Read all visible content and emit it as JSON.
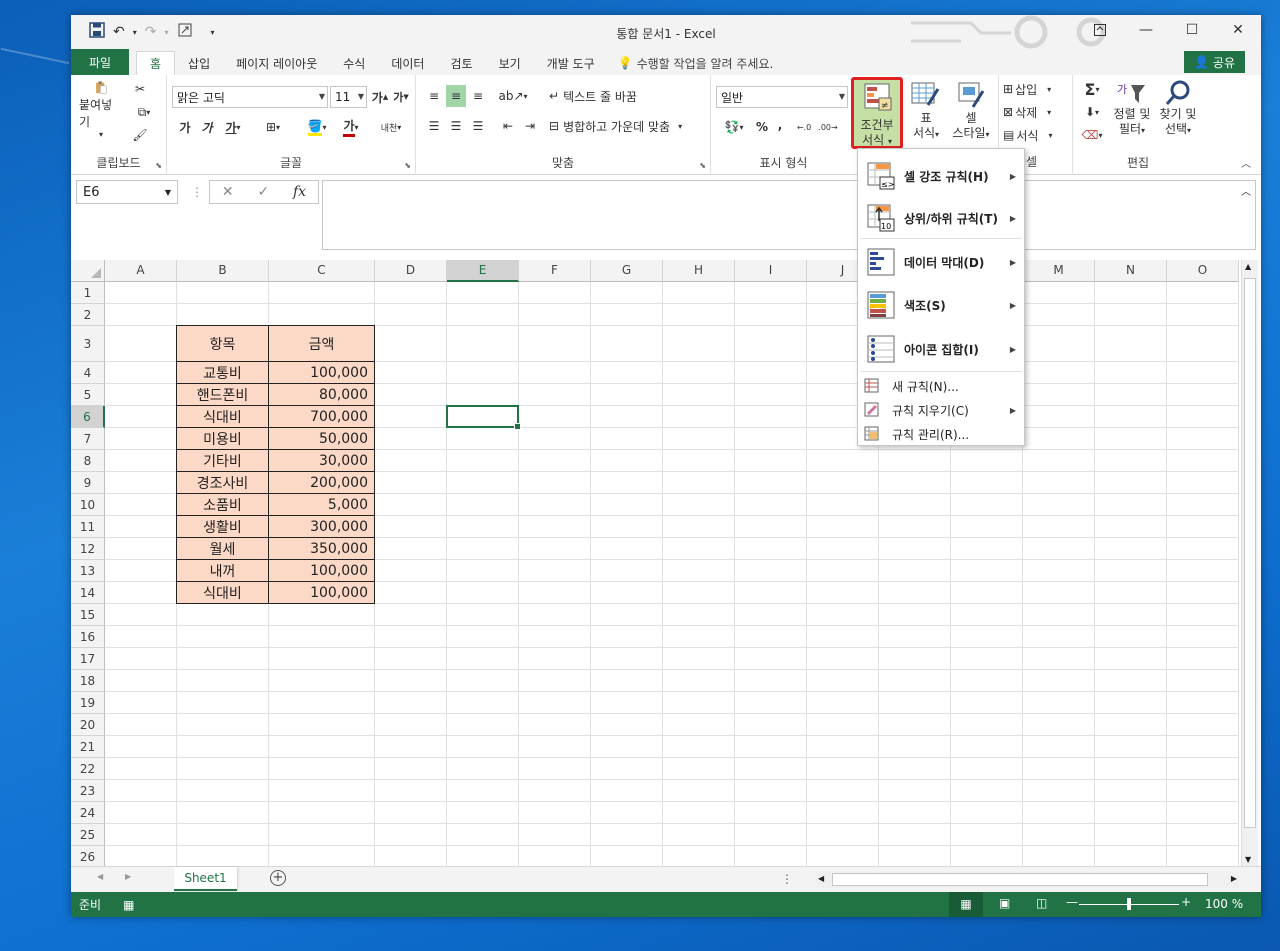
{
  "window": {
    "title": "통합 문서1  -  Excel"
  },
  "tabs": [
    {
      "label": "파일"
    },
    {
      "label": "홈"
    },
    {
      "label": "삽입"
    },
    {
      "label": "페이지 레이아웃"
    },
    {
      "label": "수식"
    },
    {
      "label": "데이터"
    },
    {
      "label": "검토"
    },
    {
      "label": "보기"
    },
    {
      "label": "개발 도구"
    }
  ],
  "tell_me": "수행할 작업을 알려 주세요.",
  "share": "공유",
  "ribbon": {
    "clipboard": {
      "paste": "붙여넣기",
      "label": "클립보드"
    },
    "font": {
      "name": "맑은 고딕",
      "size": "11",
      "bold": "가",
      "italic": "가",
      "underline": "가",
      "label": "글꼴",
      "grow": "가",
      "shrink": "가",
      "phonetic": "내천"
    },
    "alignment": {
      "wrap": "텍스트 줄 바꿈",
      "merge": "병합하고 가운데 맞춤",
      "label": "맞춤"
    },
    "number": {
      "format": "일반",
      "percent": "%",
      "comma": ",",
      "label": "표시 형식"
    },
    "styles": {
      "cf_line1": "조건부",
      "cf_line2": "서식",
      "table_line1": "표",
      "table_line2": "서식",
      "cell_line1": "셀",
      "cell_line2": "스타일"
    },
    "cells": {
      "insert": "삽입",
      "delete": "삭제",
      "format": "서식",
      "label": "셀"
    },
    "editing": {
      "sort_line1": "정렬 및",
      "sort_line2": "필터",
      "find_line1": "찾기 및",
      "find_line2": "선택",
      "label": "편집"
    }
  },
  "formula_bar": {
    "name_box": "E6",
    "fx": "fx"
  },
  "columns": [
    "A",
    "B",
    "C",
    "D",
    "E",
    "F",
    "G",
    "H",
    "I",
    "J",
    "K",
    "L",
    "M",
    "N",
    "O"
  ],
  "rows": [
    "1",
    "2",
    "3",
    "4",
    "5",
    "6",
    "7",
    "8",
    "9",
    "10",
    "11",
    "12",
    "13",
    "14",
    "15",
    "16",
    "17",
    "18",
    "19",
    "20",
    "21",
    "22",
    "23",
    "24",
    "25",
    "26"
  ],
  "table": {
    "header_item": "항목",
    "header_amount": "금액",
    "rows": [
      {
        "item": "교통비",
        "amount": "100,000"
      },
      {
        "item": "핸드폰비",
        "amount": "80,000"
      },
      {
        "item": "식대비",
        "amount": "700,000"
      },
      {
        "item": "미용비",
        "amount": "50,000"
      },
      {
        "item": "기타비",
        "amount": "30,000"
      },
      {
        "item": "경조사비",
        "amount": "200,000"
      },
      {
        "item": "소품비",
        "amount": "5,000"
      },
      {
        "item": "생활비",
        "amount": "300,000"
      },
      {
        "item": "월세",
        "amount": "350,000"
      },
      {
        "item": "내꺼",
        "amount": "100,000"
      },
      {
        "item": "식대비",
        "amount": "100,000"
      }
    ]
  },
  "menu": {
    "highlight": "셀 강조 규칙(H)",
    "topbottom": "상위/하위 규칙(T)",
    "databar": "데이터 막대(D)",
    "colorscale": "색조(S)",
    "iconset": "아이콘 집합(I)",
    "newrule": "새 규칙(N)...",
    "clear": "규칙 지우기(C)",
    "manage": "규칙 관리(R)..."
  },
  "sheet": {
    "name": "Sheet1"
  },
  "status": {
    "ready": "준비",
    "zoom": "100 %"
  },
  "colors": {
    "accent": "#217346",
    "table_fill": "#fcd9c7",
    "highlight_border": "#e02020"
  }
}
